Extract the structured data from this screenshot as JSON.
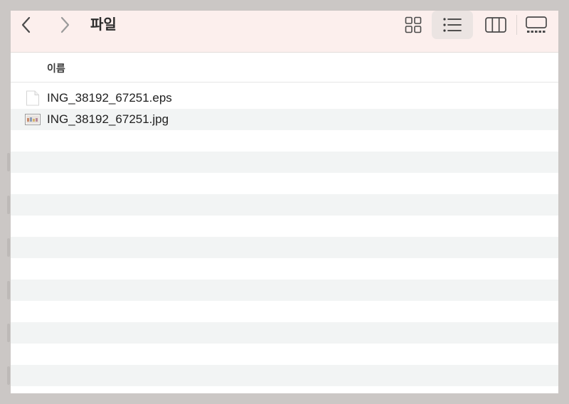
{
  "toolbar": {
    "title": "파일",
    "back_icon": "chevron-left-icon",
    "forward_icon": "chevron-right-icon",
    "views": [
      {
        "name": "icon-view",
        "icon": "grid-icon",
        "selected": false
      },
      {
        "name": "list-view",
        "icon": "list-icon",
        "selected": true
      },
      {
        "name": "column-view",
        "icon": "columns-icon",
        "selected": false
      },
      {
        "name": "gallery-view",
        "icon": "gallery-icon",
        "selected": false
      }
    ]
  },
  "table": {
    "columns": [
      {
        "label": "이름"
      }
    ],
    "files": [
      {
        "name": "ING_38192_67251.eps",
        "icon": "document-icon"
      },
      {
        "name": "ING_38192_67251.jpg",
        "icon": "image-thumbnail-icon"
      }
    ]
  },
  "colors": {
    "toolbar_bg": "#fcefed",
    "selected_view_bg": "#ebe4e2",
    "alt_row": "#f2f4f4",
    "backdrop": "#cbc7c5"
  }
}
